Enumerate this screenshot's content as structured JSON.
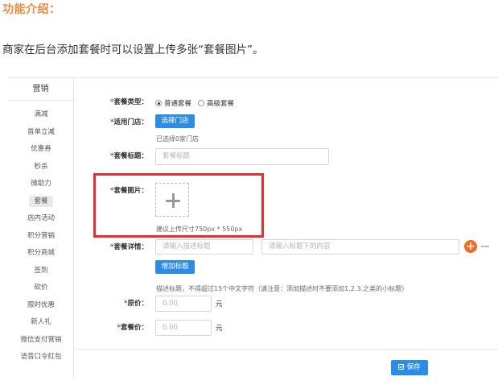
{
  "article": {
    "title": "功能介绍：",
    "intro": "商家在后台添加套餐时可以设置上传多张“套餐图片”。"
  },
  "sidebar": {
    "header": "营销",
    "items": [
      {
        "label": "满减"
      },
      {
        "label": "首单立减"
      },
      {
        "label": "优惠券"
      },
      {
        "label": "秒杀"
      },
      {
        "label": "微助力"
      },
      {
        "label": "套餐",
        "active": true
      },
      {
        "label": "店内活动"
      },
      {
        "label": "积分营销"
      },
      {
        "label": "积分商城"
      },
      {
        "label": "签到"
      },
      {
        "label": "砍价"
      },
      {
        "label": "限时优惠"
      },
      {
        "label": "新人礼"
      },
      {
        "label": "微信支付营销"
      },
      {
        "label": "语音口令红包"
      }
    ]
  },
  "form": {
    "required_mark": "*",
    "package_type": {
      "label": "套餐类型：",
      "options": [
        {
          "label": "普通套餐",
          "checked": true
        },
        {
          "label": "高级套餐",
          "checked": false
        }
      ]
    },
    "store": {
      "label": "适用门店：",
      "button": "选择门店",
      "hint": "已选择0家门店"
    },
    "package_title": {
      "label": "套餐标题：",
      "placeholder": "套餐标题"
    },
    "package_image": {
      "label": "套餐图片：",
      "hint": "建议上传尺寸750px * 550px"
    },
    "package_details": {
      "label": "套餐详情：",
      "title_placeholder": "请输入描述标题",
      "content_placeholder": "请输入标题下的内容",
      "add_button": "增加标题",
      "hint": "描述标题，不得超过15个中文字符（请注意：添加描述时不要添加1.2.3.之类的小标题）"
    },
    "original_price": {
      "label": "原价：",
      "placeholder": "0.00",
      "unit": "元"
    },
    "package_price": {
      "label": "套餐价：",
      "placeholder": "0.00",
      "unit": "元"
    },
    "save_button": "保存"
  },
  "colors": {
    "accent": "#2b8de6",
    "title_orange": "#f08a3c",
    "highlight_red": "#ec2d2d",
    "add_orange": "#f36b1f"
  }
}
